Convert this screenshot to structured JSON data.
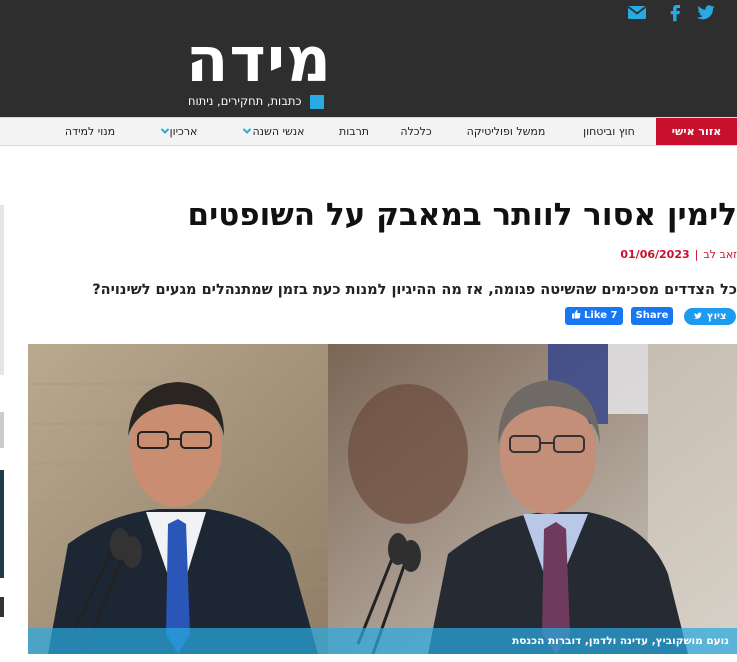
{
  "header": {
    "logo": "מידה",
    "tagline": "כתבות, תחקירים, ניתוח",
    "social": [
      "mail-icon",
      "facebook-icon",
      "twitter-icon"
    ]
  },
  "nav": {
    "items": [
      {
        "label": "אזור אישי",
        "active": true,
        "dropdown": false
      },
      {
        "label": "חוץ וביטחון",
        "active": false,
        "dropdown": false
      },
      {
        "label": "ממשל ופוליטיקה",
        "active": false,
        "dropdown": false
      },
      {
        "label": "כלכלה",
        "active": false,
        "dropdown": false
      },
      {
        "label": "תרבות",
        "active": false,
        "dropdown": false
      },
      {
        "label": "אנשי השנה",
        "active": false,
        "dropdown": true
      },
      {
        "label": "ארכיון",
        "active": false,
        "dropdown": true
      },
      {
        "label": "מנוי למידה",
        "active": false,
        "dropdown": false
      }
    ]
  },
  "article": {
    "title": "לימין אסור לוותר במאבק על השופטים",
    "author": "זאב לב",
    "separator": "|",
    "date": "01/06/2023",
    "subtitle": "כל הצדדים מסכימים שהשיטה פגומה, אז מה ההיגיון למנות כעת בזמן שמתנהלים מגעים לשינויה?",
    "share": {
      "like_label": "Like",
      "like_count": "7",
      "share_label": "Share",
      "tweet_label": "ציוץ"
    },
    "photo_caption": "נועם מושקוביץ, עדינה ולדמן, דוברות הכנסת"
  },
  "colors": {
    "header_bg": "#2e2e2e",
    "accent_red": "#c8102e",
    "accent_blue": "#29a9e1",
    "facebook_blue": "#1877f2",
    "twitter_blue": "#1d9bf0"
  }
}
